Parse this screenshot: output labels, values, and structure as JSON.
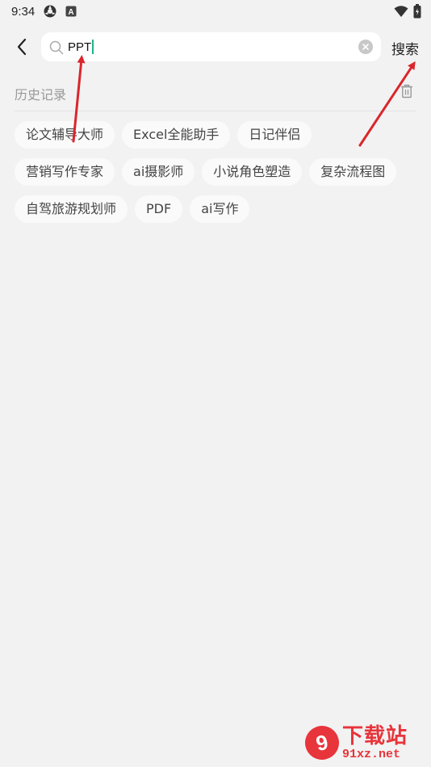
{
  "status_bar": {
    "time": "9:34",
    "icons": [
      "sync-icon",
      "a-box-icon"
    ],
    "right_icons": [
      "wifi-icon",
      "battery-icon"
    ]
  },
  "search": {
    "value": "PPT",
    "search_label": "搜索"
  },
  "history": {
    "title": "历史记录",
    "chips": [
      "论文辅导大师",
      "Excel全能助手",
      "日记伴侣",
      "营销写作专家",
      "ai摄影师",
      "小说角色塑造",
      "复杂流程图",
      "自驾旅游规划师",
      "PDF",
      "ai写作"
    ]
  },
  "watermark": {
    "logo": "9",
    "brand": "下载站",
    "url": "91xz.net"
  },
  "colors": {
    "background": "#f2f2f2",
    "annotation_arrow": "#d9262c",
    "caret": "#1fb38a",
    "watermark": "#e8343b"
  }
}
